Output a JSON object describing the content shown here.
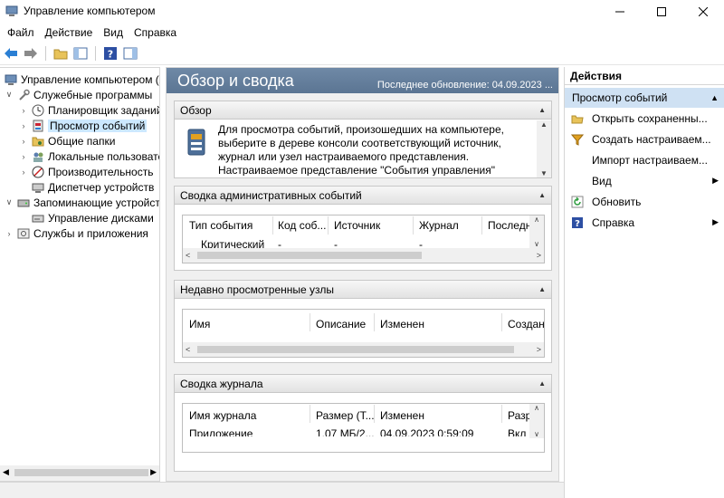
{
  "window": {
    "title": "Управление компьютером"
  },
  "menu": [
    "Файл",
    "Действие",
    "Вид",
    "Справка"
  ],
  "tree": {
    "root": "Управление компьютером (л",
    "service": "Служебные программы",
    "scheduler": "Планировщик заданий",
    "eventviewer": "Просмотр событий",
    "shared": "Общие папки",
    "localusers": "Локальные пользовате",
    "performance": "Производительность",
    "devmgr": "Диспетчер устройств",
    "storage": "Запоминающие устройст",
    "diskmgmt": "Управление дисками",
    "services": "Службы и приложения"
  },
  "center": {
    "title": "Обзор и сводка",
    "updated": "Последнее обновление: 04.09.2023 ...",
    "overview": {
      "title": "Обзор",
      "text": "Для просмотра событий, произошедших на компьютере, выберите в дереве консоли соответствующий источник, журнал или узел настраиваемого представления. Настраиваемое представление \"События управления\" включает все события"
    },
    "admin": {
      "title": "Сводка административных событий",
      "cols": [
        "Тип события",
        "Код соб...",
        "Источник",
        "Журнал",
        "Последн"
      ],
      "row": [
        "Критический",
        "-",
        "-",
        "-"
      ]
    },
    "recent": {
      "title": "Недавно просмотренные узлы",
      "cols": [
        "Имя",
        "Описание",
        "Изменен",
        "Создан"
      ]
    },
    "logs": {
      "title": "Сводка журнала",
      "cols": [
        "Имя журнала",
        "Размер (Т...",
        "Изменен",
        "Разр"
      ],
      "row": [
        "Приложение",
        "1,07 МБ/2...",
        "04.09.2023 0:59:09",
        "Вкл"
      ]
    }
  },
  "actions": {
    "title": "Действия",
    "section": "Просмотр событий",
    "items": [
      "Открыть сохраненны...",
      "Создать настраиваем...",
      "Импорт настраиваем...",
      "Вид",
      "Обновить",
      "Справка"
    ]
  }
}
